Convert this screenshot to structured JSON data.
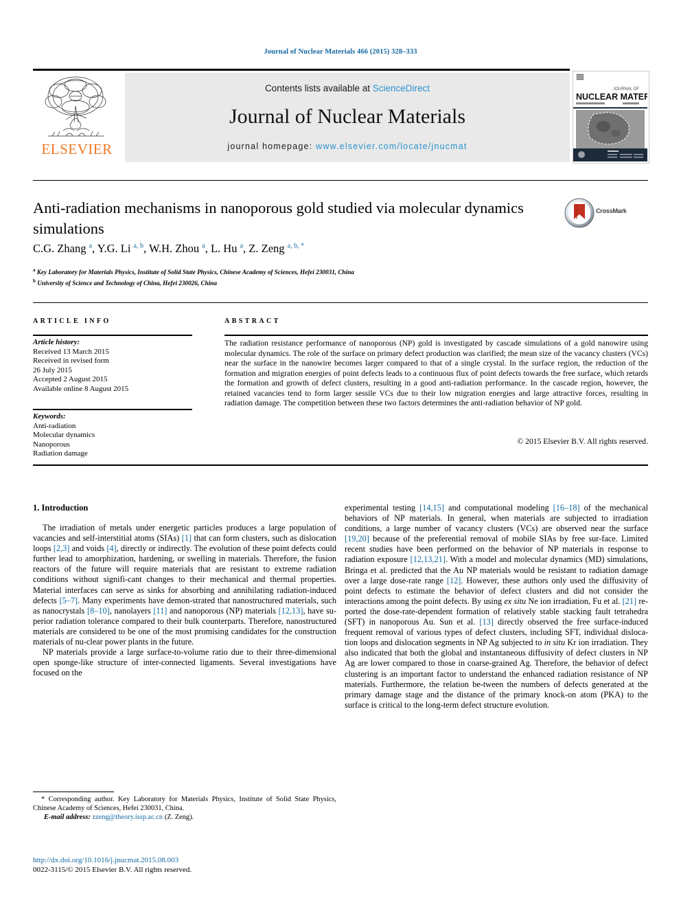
{
  "running_head": "Journal of Nuclear Materials 466 (2015) 328–333",
  "masthead": {
    "contents_prefix": "Contents lists available at ",
    "sciencedirect": "ScienceDirect",
    "journal_title": "Journal of Nuclear Materials",
    "homepage_prefix": "journal homepage: ",
    "homepage_url": "www.elsevier.com/locate/jnucmat",
    "publisher": "ELSEVIER",
    "cover_top_label": "JOURNAL OF",
    "cover_title": "NUCLEAR MATERIALS",
    "accent_blue": "#2b92d0",
    "elsevier_orange": "#ef7622"
  },
  "article": {
    "title": "Anti-radiation mechanisms in nanoporous gold studied via molecular dynamics simulations",
    "crossmark_label": "CrossMark",
    "authors_html": "C.G. Zhang <sup>a</sup>, Y.G. Li <sup>a, b</sup>, W.H. Zhou <sup>a</sup>, L. Hu <sup>a</sup>, Z. Zeng <sup>a, b, *</sup>",
    "affiliation_a": "Key Laboratory for Materials Physics, Institute of Solid State Physics, Chinese Academy of Sciences, Hefei 230031, China",
    "affiliation_b": "University of Science and Technology of China, Hefei 230026, China"
  },
  "info": {
    "header_info": "ARTICLE INFO",
    "header_abstract": "ABSTRACT",
    "history_label": "Article history:",
    "history_lines": [
      "Received 13 March 2015",
      "Received in revised form",
      "26 July 2015",
      "Accepted 2 August 2015",
      "Available online 8 August 2015"
    ],
    "keywords_label": "Keywords:",
    "keywords": [
      "Anti-radiation",
      "Molecular dynamics",
      "Nanoporous",
      "Radiation damage"
    ],
    "abstract": "The radiation resistance performance of nanoporous (NP) gold is investigated by cascade simulations of a gold nanowire using molecular dynamics. The role of the surface on primary defect production was clarified; the mean size of the vacancy clusters (VCs) near the surface in the nanowire becomes larger compared to that of a single crystal. In the surface region, the reduction of the formation and migration energies of point defects leads to a continuous flux of point defects towards the free surface, which retards the formation and growth of defect clusters, resulting in a good anti-radiation performance. In the cascade region, however, the retained vacancies tend to form larger sessile VCs due to their low migration energies and large attractive forces, resulting in radiation damage. The competition between these two factors determines the anti-radiation behavior of NP gold.",
    "copyright": "© 2015 Elsevier B.V. All rights reserved."
  },
  "body": {
    "section_heading": "1. Introduction",
    "left_paragraphs": [
      "The irradiation of metals under energetic particles produces a large population of vacancies and self-interstitial atoms (SIAs) <span class=\"ref\">[1]</span> that can form clusters, such as dislocation loops <span class=\"ref\">[2,3]</span> and voids <span class=\"ref\">[4]</span>, directly or indirectly. The evolution of these point defects could further lead to amorphization, hardening, or swelling in materials. Therefore, the fusion reactors of the future will require materials that are resistant to extreme radiation conditions without signifi-cant changes to their mechanical and thermal properties. Material interfaces can serve as sinks for absorbing and annihilating radiation-induced defects <span class=\"ref\">[5–7]</span>. Many experiments have demon-strated that nanostructured materials, such as nanocrystals <span class=\"ref\">[8–10]</span>, nanolayers <span class=\"ref\">[11]</span> and nanoporous (NP) materials <span class=\"ref\">[12,13]</span>, have su-perior radiation tolerance compared to their bulk counterparts. Therefore, nanostructured materials are considered to be one of the most promising candidates for the construction materials of nu-clear power plants in the future.",
      "NP materials provide a large surface-to-volume ratio due to their three-dimensional open sponge-like structure of inter-connected ligaments. Several investigations have focused on the"
    ],
    "right_paragraphs": [
      "experimental testing <span class=\"ref\">[14,15]</span> and computational modeling <span class=\"ref\">[16–18]</span> of the mechanical behaviors of NP materials. In general, when materials are subjected to irradiation conditions, a large number of vacancy clusters (VCs) are observed near the surface <span class=\"ref\">[19,20]</span> because of the preferential removal of mobile SIAs by free sur-face. Limited recent studies have been performed on the behavior of NP materials in response to radiation exposure <span class=\"ref\">[12,13,21]</span>. With a model and molecular dynamics (MD) simulations, Bringa et al. predicted that the Au NP materials would be resistant to radiation damage over a large dose-rate range <span class=\"ref\">[12]</span>. However, these authors only used the diffusivity of point defects to estimate the behavior of defect clusters and did not consider the interactions among the point defects. By using <i>ex situ</i> Ne ion irradiation, Fu et al. <span class=\"ref\">[21]</span> re-ported the dose-rate-dependent formation of relatively stable stacking fault tetrahedra (SFT) in nanoporous Au. Sun et al. <span class=\"ref\">[13]</span> directly observed the free surface-induced frequent removal of various types of defect clusters, including SFT, individual disloca-tion loops and dislocation segments in NP Ag subjected to <i>in situ</i> Kr ion irradiation. They also indicated that both the global and instantaneous diffusivity of defect clusters in NP Ag are lower compared to those in coarse-grained Ag. Therefore, the behavior of defect clustering is an important factor to understand the enhanced radiation resistance of NP materials. Furthermore, the relation be-tween the numbers of defects generated at the primary damage stage and the distance of the primary knock-on atom (PKA) to the surface is critical to the long-term defect structure evolution."
    ]
  },
  "footer": {
    "corresponding_marker": "*",
    "corresponding_text": "Corresponding author. Key Laboratory for Materials Physics, Institute of Solid State Physics, Chinese Academy of Sciences, Hefei 230031, China.",
    "email_label": "E-mail address:",
    "email": "zzeng@theory.issp.ac.cn",
    "email_suffix": "(Z. Zeng).",
    "doi_url": "http://dx.doi.org/10.1016/j.jnucmat.2015.08.003",
    "issn_line": "0022-3115/© 2015 Elsevier B.V. All rights reserved."
  }
}
